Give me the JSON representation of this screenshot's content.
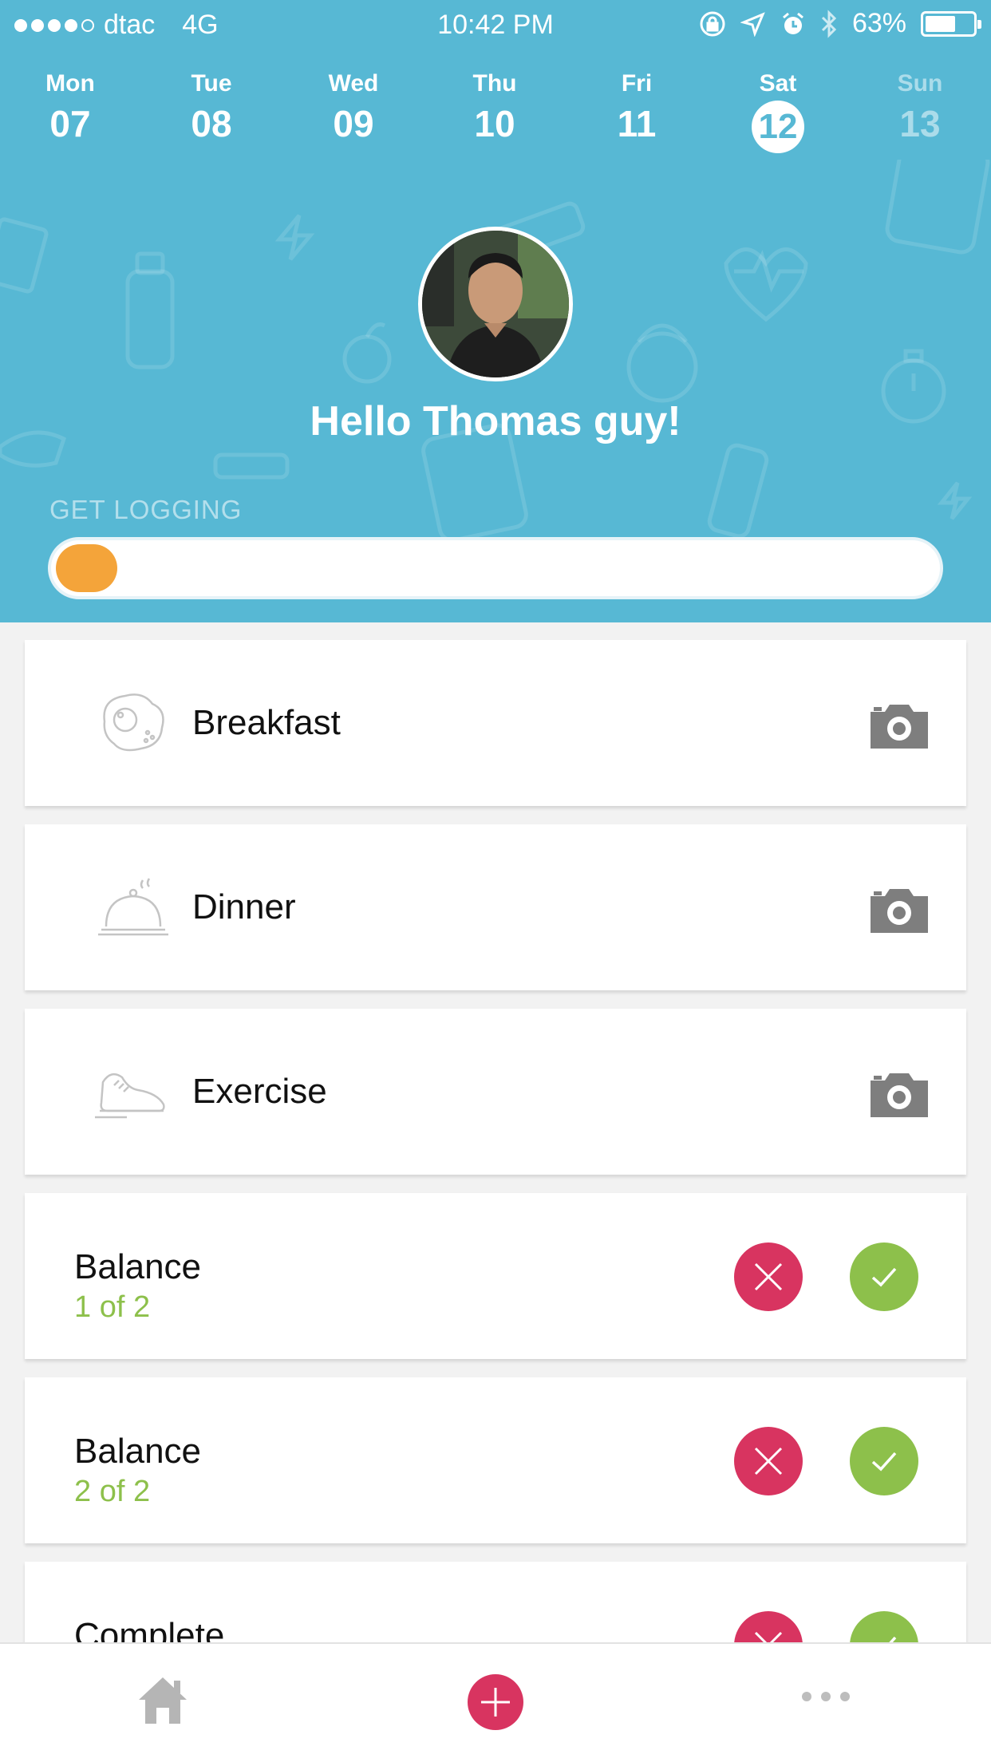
{
  "status_bar": {
    "carrier": "dtac",
    "network": "4G",
    "time": "10:42 PM",
    "battery": "63%",
    "battery_level": 0.63
  },
  "days": [
    {
      "name": "Mon",
      "num": "07"
    },
    {
      "name": "Tue",
      "num": "08"
    },
    {
      "name": "Wed",
      "num": "09"
    },
    {
      "name": "Thu",
      "num": "10"
    },
    {
      "name": "Fri",
      "num": "11"
    },
    {
      "name": "Sat",
      "num": "12",
      "selected": true
    },
    {
      "name": "Sun",
      "num": "13",
      "faded": true
    }
  ],
  "profile": {
    "greeting": "Hello Thomas guy!"
  },
  "logging": {
    "label": "GET LOGGING",
    "progress": 0.07
  },
  "log_items": [
    {
      "label": "Breakfast",
      "icon": "fried-egg-icon"
    },
    {
      "label": "Dinner",
      "icon": "cloche-icon"
    },
    {
      "label": "Exercise",
      "icon": "sneaker-icon"
    }
  ],
  "balance_items": [
    {
      "title": "Balance",
      "subtitle": "1 of 2"
    },
    {
      "title": "Balance",
      "subtitle": "2 of 2"
    },
    {
      "title": "Complete",
      "subtitle": ""
    }
  ],
  "colors": {
    "header": "#57b8d4",
    "progress": "#f4a43a",
    "reject": "#d83460",
    "accept": "#8dc04b"
  },
  "tabbar": {
    "items": [
      "home-icon",
      "add-icon",
      "more-icon"
    ]
  }
}
